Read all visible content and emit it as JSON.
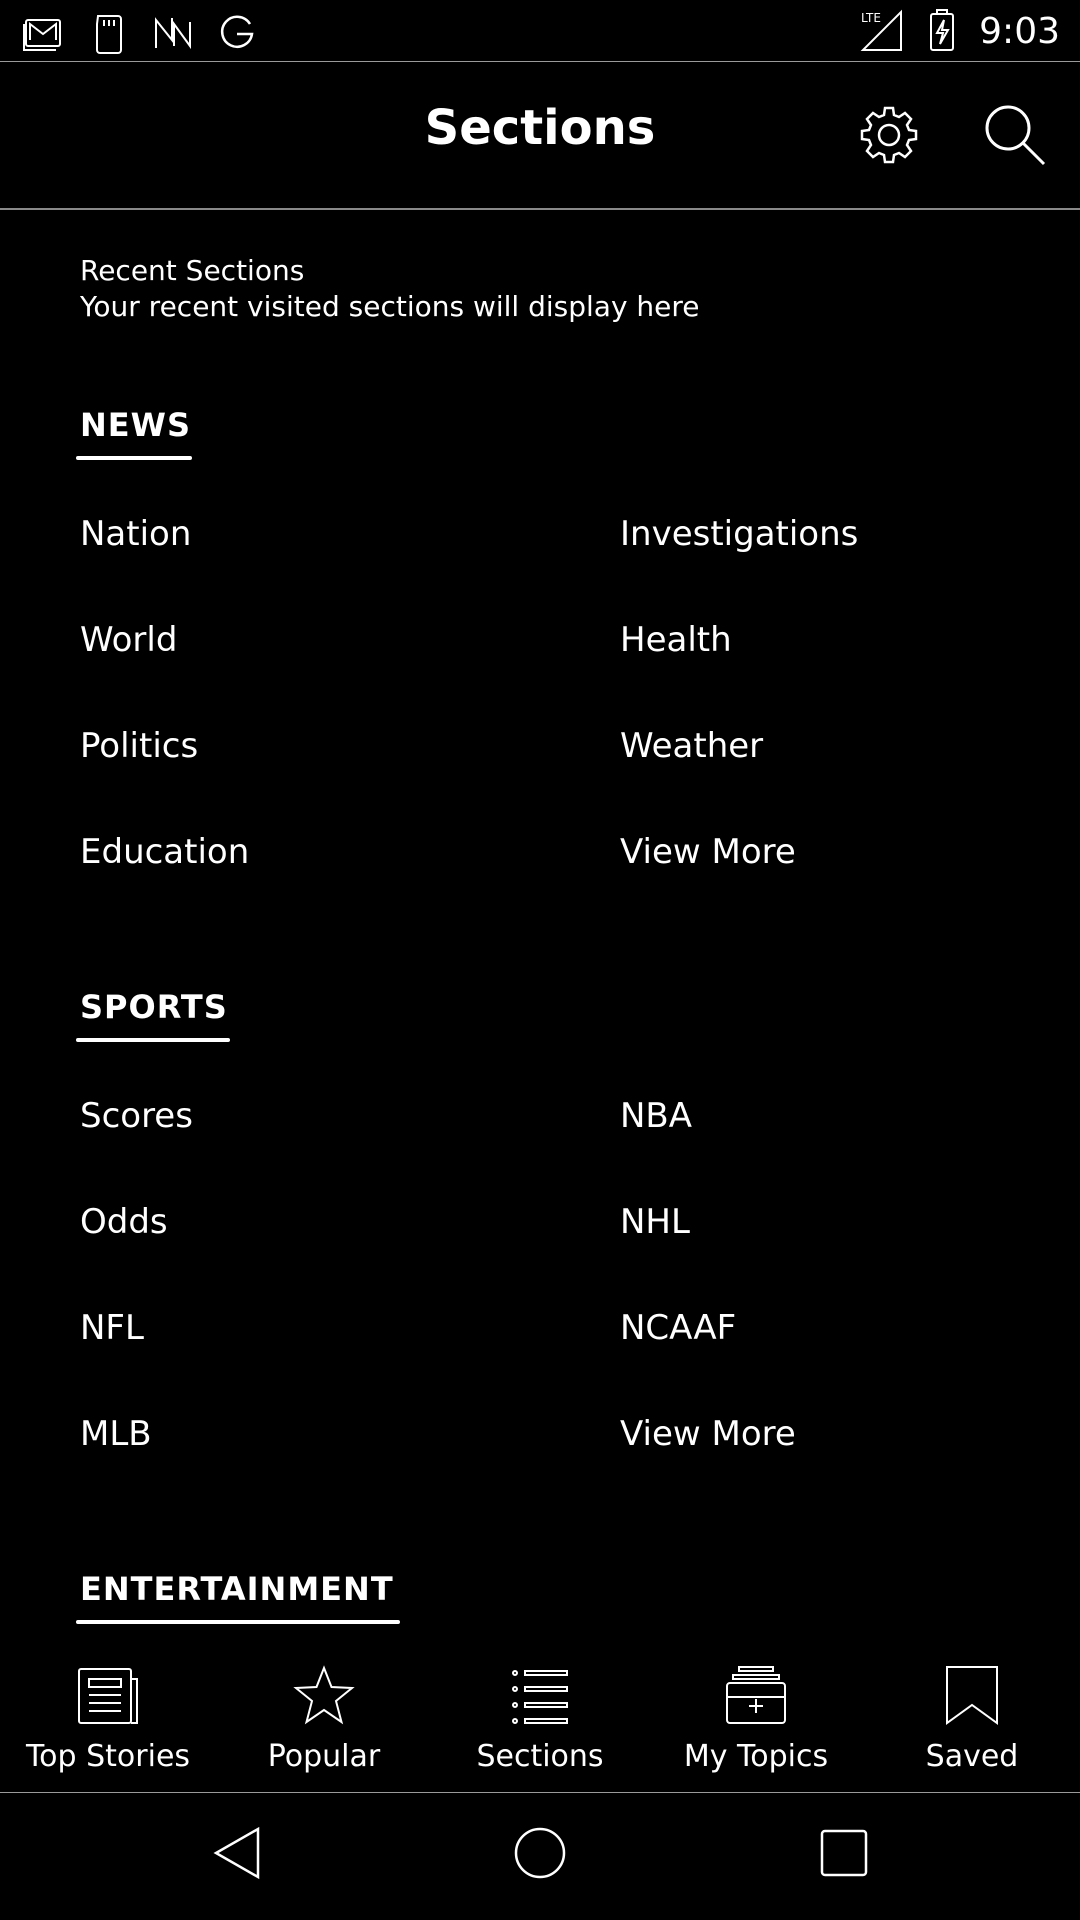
{
  "status_bar": {
    "time": "9:03",
    "left_icons": [
      "gmail-icon",
      "sd-card-icon",
      "news-app-icon",
      "google-icon"
    ],
    "right_icons": [
      "lte-signal-icon",
      "battery-charging-icon"
    ]
  },
  "header": {
    "title": "Sections"
  },
  "recent": {
    "title": "Recent Sections",
    "description": "Your recent visited sections will display here"
  },
  "sections": {
    "news": {
      "heading": "NEWS",
      "items": [
        "Nation",
        "Investigations",
        "World",
        "Health",
        "Politics",
        "Weather",
        "Education",
        "View More"
      ]
    },
    "sports": {
      "heading": "SPORTS",
      "items": [
        "Scores",
        "NBA",
        "Odds",
        "NHL",
        "NFL",
        "NCAAF",
        "MLB",
        "View More"
      ]
    },
    "entertainment": {
      "heading": "ENTERTAINMENT"
    }
  },
  "bottom_nav": {
    "items": [
      {
        "label": "Top Stories",
        "icon": "newspaper-icon"
      },
      {
        "label": "Popular",
        "icon": "star-icon"
      },
      {
        "label": "Sections",
        "icon": "list-icon"
      },
      {
        "label": "My Topics",
        "icon": "topics-add-icon"
      },
      {
        "label": "Saved",
        "icon": "bookmark-icon"
      }
    ]
  }
}
